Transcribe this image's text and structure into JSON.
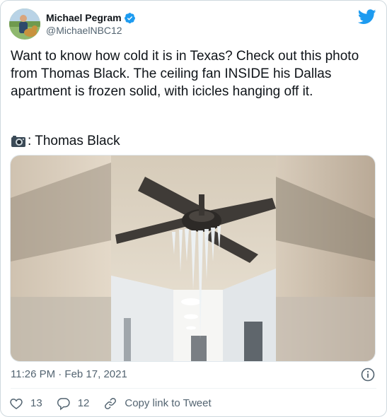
{
  "author": {
    "display_name": "Michael Pegram",
    "handle": "@MichaelNBC12"
  },
  "tweet": {
    "text": "Want to know how cold it is in Texas? Check out this photo from Thomas Black. The ceiling fan INSIDE his Dallas apartment is frozen solid, with icicles hanging off it.",
    "photo_credit": ": Thomas Black",
    "timestamp": "11:26 PM · Feb 17, 2021"
  },
  "actions": {
    "likes": "13",
    "replies": "12",
    "copy_link_label": "Copy link to Tweet"
  },
  "colors": {
    "brand_blue": "#1d9bf0",
    "text_primary": "#0f1419",
    "text_secondary": "#536471",
    "border": "#cfd9de"
  },
  "icons": [
    "verified-badge-icon",
    "twitter-bird-icon",
    "camera-icon",
    "info-icon",
    "heart-icon",
    "reply-icon",
    "link-icon"
  ]
}
